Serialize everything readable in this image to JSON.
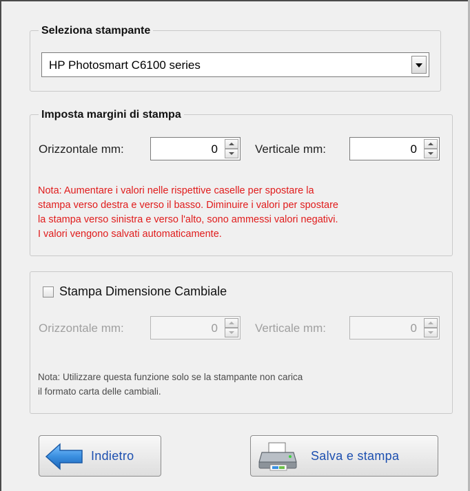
{
  "printer": {
    "group_title": "Seleziona stampante",
    "selected": "HP Photosmart C6100 series"
  },
  "margins": {
    "group_title": "Imposta margini di stampa",
    "horizontal_label": "Orizzontale mm:",
    "horizontal_value": "0",
    "vertical_label": "Verticale mm:",
    "vertical_value": "0",
    "note_lines": [
      "Nota: Aumentare i valori nelle rispettive caselle per spostare la",
      "stampa verso destra e verso il basso. Diminuire i valori per spostare",
      "la stampa verso sinistra e verso l'alto, sono ammessi valori negativi.",
      "I valori vengono salvati automaticamente."
    ]
  },
  "cambiale": {
    "checkbox_label": "Stampa Dimensione Cambiale",
    "checked": false,
    "horizontal_label": "Orizzontale mm:",
    "horizontal_value": "0",
    "vertical_label": "Verticale mm:",
    "vertical_value": "0",
    "note_lines": [
      "Nota: Utilizzare questa funzione solo se la stampante non carica",
      "il formato carta delle cambiali."
    ]
  },
  "buttons": {
    "back_label": "Indietro",
    "save_print_label": "Salva e stampa"
  },
  "icons": {
    "back": "left-arrow-icon",
    "print": "printer-icon"
  },
  "colors": {
    "note_red": "#e01b1b",
    "button_text": "#1c4fb0",
    "arrow_blue": "#3a8fe0"
  }
}
